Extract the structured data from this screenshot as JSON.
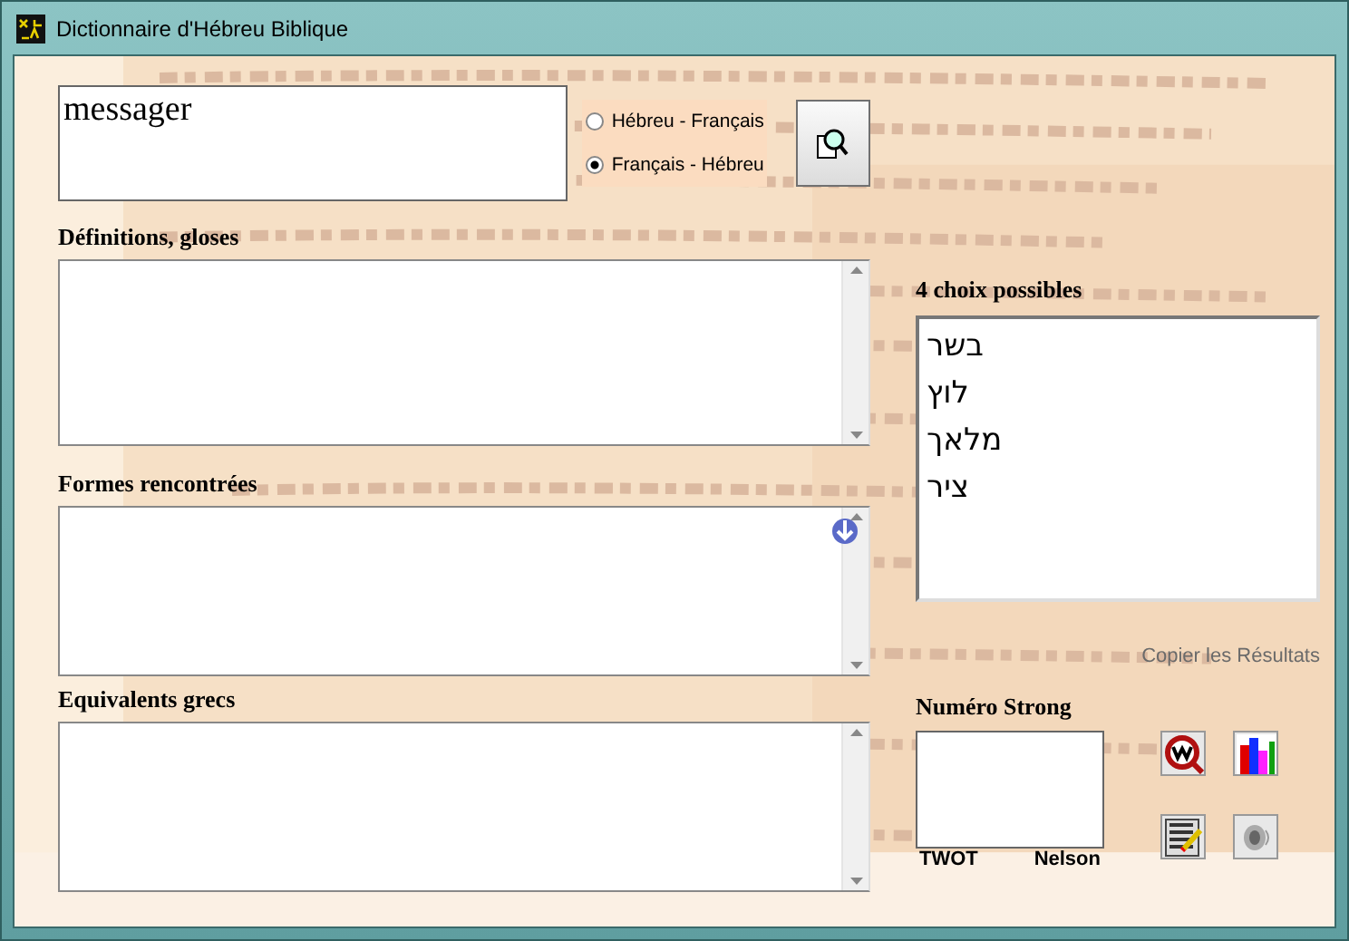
{
  "window": {
    "title": "Dictionnaire d'Hébreu Biblique"
  },
  "search": {
    "value": "messager"
  },
  "direction": [
    {
      "label": "Hébreu - Français",
      "selected": false
    },
    {
      "label": "Français - Hébreu",
      "selected": true
    }
  ],
  "sections": [
    {
      "label": "Définitions, gloses"
    },
    {
      "label": "Formes rencontrées"
    },
    {
      "label": "Equivalents grecs"
    }
  ],
  "choices": {
    "label": "4 choix possibles",
    "items": [
      "בשר",
      "לוץ",
      "מלאך",
      "ציר"
    ]
  },
  "copy_link": "Copier les Résultats",
  "strong": {
    "label": "Numéro Strong",
    "column_labels": [
      "TWOT",
      "Nelson"
    ]
  },
  "tools": [
    {
      "kind": "lexicon"
    },
    {
      "kind": "chart"
    },
    {
      "kind": "notes"
    },
    {
      "kind": "sound"
    }
  ]
}
